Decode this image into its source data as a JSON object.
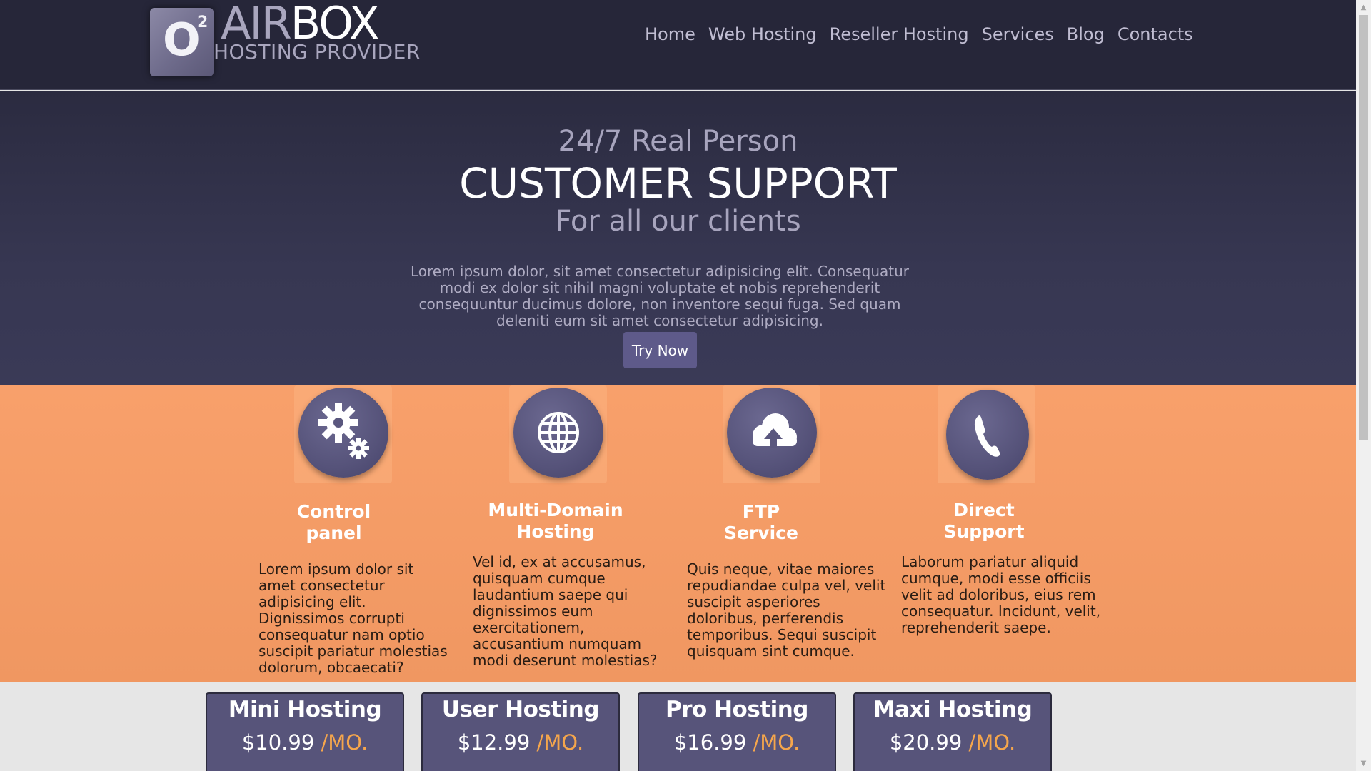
{
  "brand": {
    "logo_letter": "O",
    "logo_sup": "2",
    "name_part1": "AIR",
    "name_part2": "BOX",
    "tagline": "HOSTING PROVIDER"
  },
  "nav": {
    "items": [
      {
        "label": "Home"
      },
      {
        "label": "Web Hosting"
      },
      {
        "label": "Reseller Hosting"
      },
      {
        "label": "Services"
      },
      {
        "label": "Blog"
      },
      {
        "label": "Contacts"
      }
    ]
  },
  "hero": {
    "line1": "24/7 Real Person",
    "line2": "CUSTOMER SUPPORT",
    "line3": "For all our clients",
    "paragraph": "Lorem ipsum dolor, sit amet consectetur adipisicing elit. Consequatur modi ex dolor sit nihil magni voluptate et nobis reprehenderit consequuntur ducimus dolore, non inventore sequi fuga. Sed quam deleniti eum sit amet consectetur adipisicing.",
    "cta_label": "Try Now"
  },
  "features": [
    {
      "icon": "gears-icon",
      "title": "Control panel",
      "text": "Lorem ipsum dolor sit amet consectetur adipisicing elit. Dignissimos corrupti consequatur nam optio suscipit pariatur molestias dolorum, obcaecati?"
    },
    {
      "icon": "globe-icon",
      "title": "Multi-Domain Hosting",
      "text": "Vel id, ex at accusamus, quisquam cumque laudantium saepe qui dignissimos eum exercitationem, accusantium numquam modi deserunt molestias?"
    },
    {
      "icon": "cloud-upload-icon",
      "title": "FTP Service",
      "text": "Quis neque, vitae maiores repudiandae culpa vel, velit suscipit asperiores doloribus, perferendis temporibus. Sequi suscipit quisquam sint cumque."
    },
    {
      "icon": "phone-icon",
      "title": "Direct Support",
      "text": "Laborum pariatur aliquid cumque, modi esse officiis velit ad doloribus, eius rem consequatur. Incidunt, velit, reprehenderit saepe."
    }
  ],
  "plans": [
    {
      "name": "Mini Hosting",
      "price": "$10.99",
      "period": "/MO."
    },
    {
      "name": "User Hosting",
      "price": "$12.99",
      "period": "/MO."
    },
    {
      "name": "Pro Hosting",
      "price": "$16.99",
      "period": "/MO."
    },
    {
      "name": "Maxi Hosting",
      "price": "$20.99",
      "period": "/MO."
    }
  ],
  "colors": {
    "header_bg": "#262639",
    "hero_bg": "#373752",
    "features_bg": "#f39a64",
    "accent_button": "#5e5a8a",
    "price_period": "#f5a64c",
    "plan_bg": "#57547a"
  }
}
